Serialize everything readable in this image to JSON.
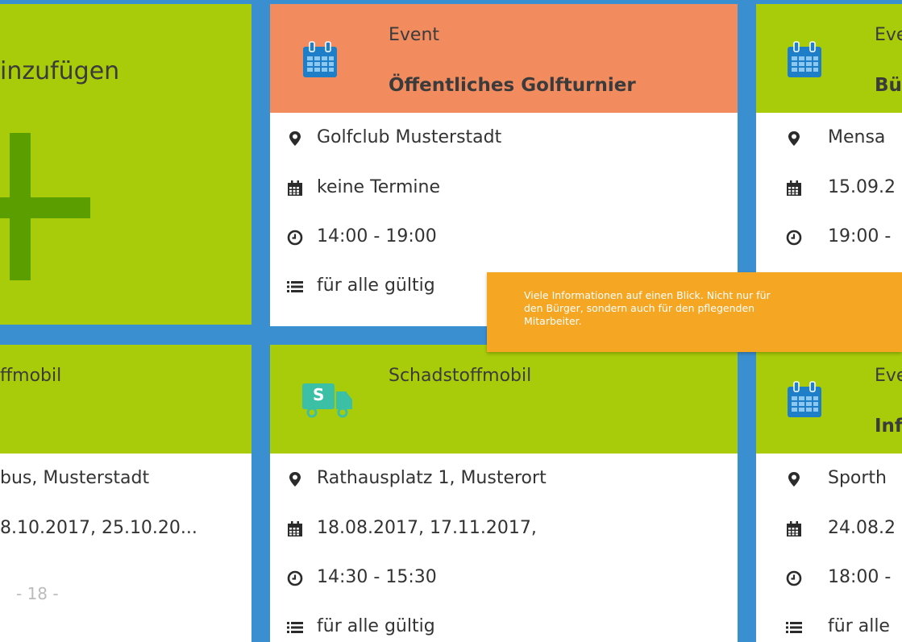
{
  "add_card": {
    "label": "inzufügen",
    "plus_color": "#5a9e00"
  },
  "card_golf": {
    "type": "Event",
    "title": "Öffentliches Golfturnier",
    "location": "Golfclub Musterstadt",
    "dates": "keine Termine",
    "time": "14:00 - 19:00",
    "validity": "für alle gültig",
    "header_color": "#f28c5f",
    "icon": "calendar-icon"
  },
  "card_right_top": {
    "type": "Eve",
    "title": "Bü",
    "location": "Mensa",
    "dates": "15.09.2",
    "time": "19:00 -",
    "icon": "calendar-icon"
  },
  "card_left_bottom": {
    "type": "ffmobil",
    "location": "bus, Musterstadt",
    "dates": "8.10.2017, 25.10.20..."
  },
  "card_schad": {
    "type": "Schadstoffmobil",
    "location": "Rathausplatz 1, Musterort",
    "dates": "18.08.2017, 17.11.2017,",
    "time": "14:30 - 15:30",
    "validity": "für alle gültig",
    "icon": "truck-icon",
    "truck_letter": "S"
  },
  "card_right_bottom": {
    "type": "Eve",
    "title": "Inf",
    "location": "Sporth",
    "dates": "24.08.2",
    "time": "18:00 -",
    "validity": "für alle",
    "icon": "calendar-icon"
  },
  "tooltip": {
    "text": "Viele Informationen auf einen Blick. Nicht nur für den Bürger, sondern auch für den pflegenden Mitarbeiter."
  },
  "page_number": "- 18 -",
  "colors": {
    "background": "#3a8fd1",
    "green": "#a8cc0a",
    "orange": "#f28c5f",
    "tooltip": "#f5a623",
    "icon_blue": "#1e7fc8",
    "truck_teal": "#3bbfa5"
  }
}
